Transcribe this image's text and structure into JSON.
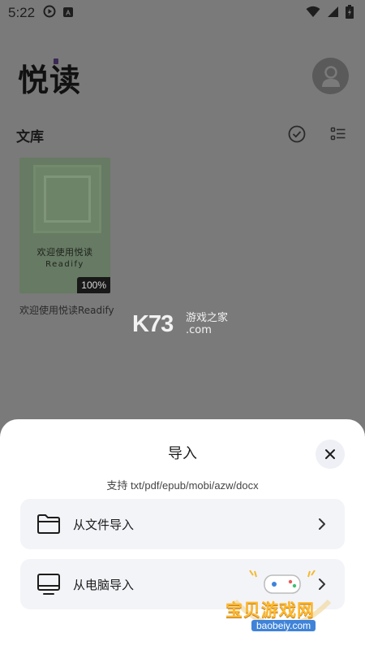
{
  "status_bar": {
    "time": "5:22"
  },
  "app": {
    "title": "悦读"
  },
  "library": {
    "title": "文库",
    "books": [
      {
        "cover_title": "欢迎使用悦读",
        "cover_subtitle": "Readify",
        "progress_text": "100%",
        "name": "欢迎使用悦读Readify"
      }
    ]
  },
  "watermark": {
    "logo": "K73",
    "tag_line1": "游戏之家",
    "tag_line2": ".com",
    "corner_text": "宝贝游戏网",
    "corner_url": "baobeiy.com"
  },
  "import_sheet": {
    "title": "导入",
    "subtitle": "支持 txt/pdf/epub/mobi/azw/docx",
    "options": [
      {
        "label": "从文件导入",
        "icon": "folder-icon"
      },
      {
        "label": "从电脑导入",
        "icon": "monitor-icon"
      }
    ]
  },
  "colors": {
    "overlay": "#7a7a7a",
    "sheet_bg": "#ffffff",
    "option_bg": "#f3f4f8",
    "accent_purple": "#3a2a55"
  }
}
